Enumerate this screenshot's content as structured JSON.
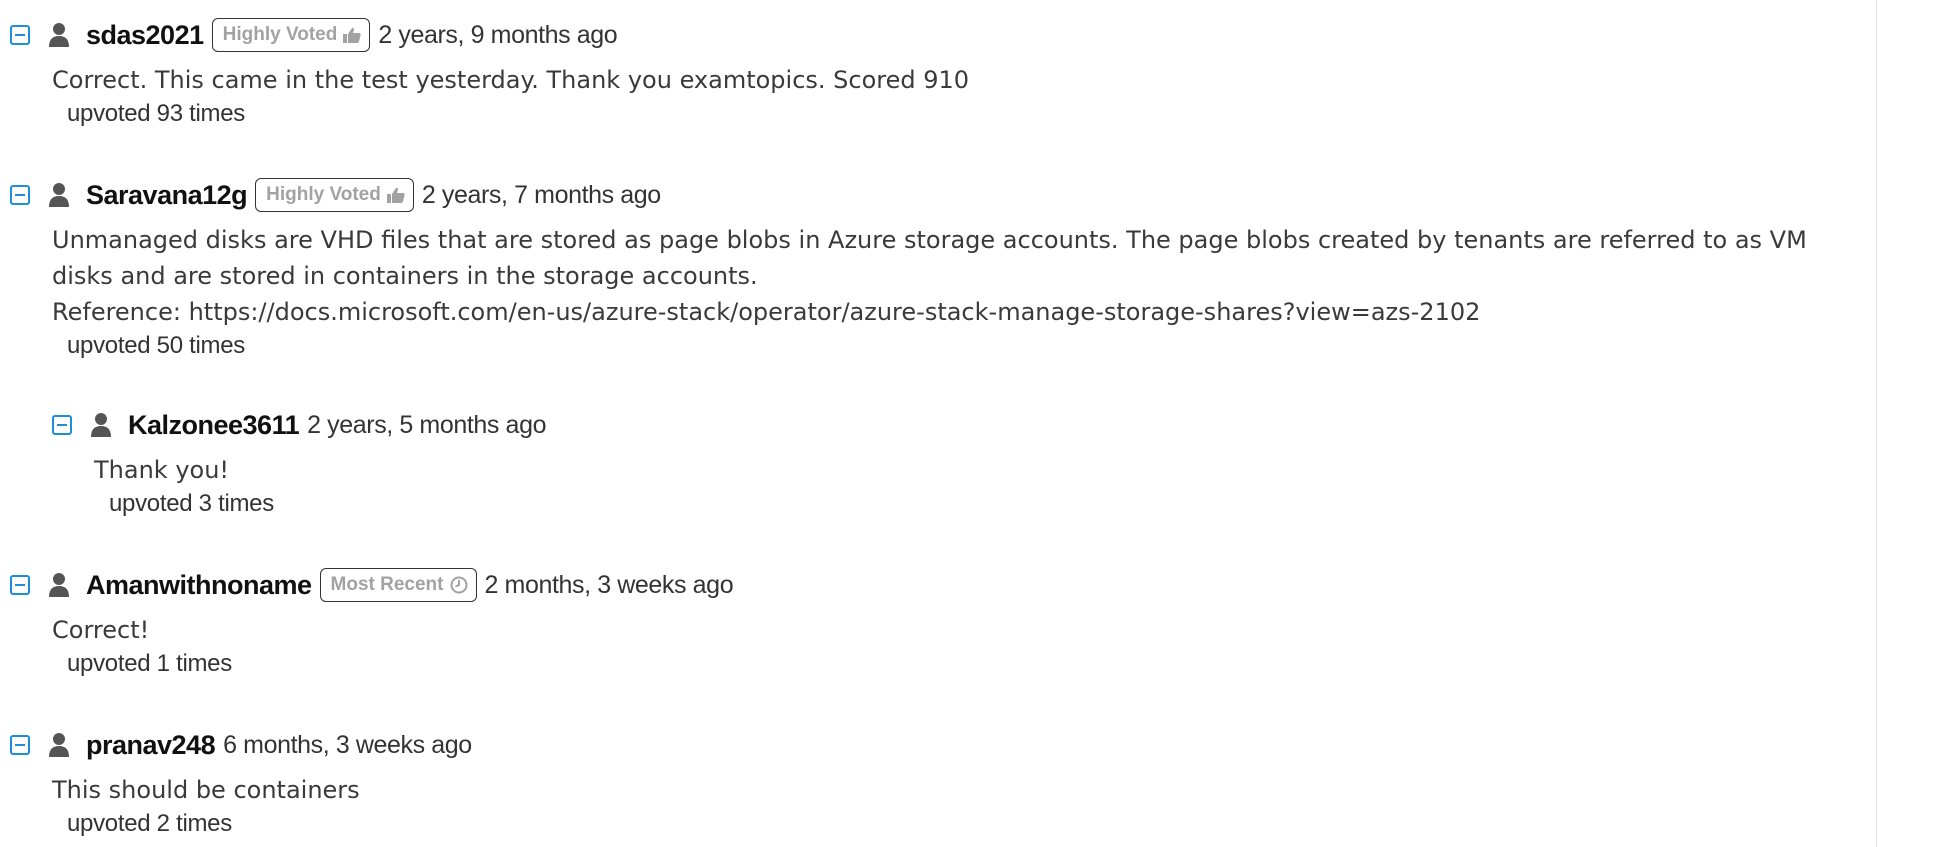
{
  "comments": [
    {
      "username": "sdas2021",
      "badge": "Highly Voted",
      "badge_icon": "thumbs-up-icon",
      "timestamp": "2 years, 9 months ago",
      "body_lines": [
        "Correct. This came in the test yesterday. Thank you examtopics. Scored 910"
      ],
      "upvotes": "upvoted 93 times"
    },
    {
      "username": "Saravana12g",
      "badge": "Highly Voted",
      "badge_icon": "thumbs-up-icon",
      "timestamp": "2 years, 7 months ago",
      "body_lines": [
        "Unmanaged disks are VHD files that are stored as page blobs in Azure storage accounts. The page blobs created by tenants are referred to as VM",
        "disks and are stored in containers in the storage accounts.",
        "Reference: https://docs.microsoft.com/en-us/azure-stack/operator/azure-stack-manage-storage-shares?view=azs-2102"
      ],
      "upvotes": "upvoted 50 times"
    },
    {
      "username": "Kalzonee3611",
      "timestamp": "2 years, 5 months ago",
      "body_lines": [
        "Thank you!"
      ],
      "upvotes": "upvoted 3 times"
    },
    {
      "username": "Amanwithnoname",
      "badge": "Most Recent",
      "badge_icon": "clock-icon",
      "timestamp": "2 months, 3 weeks ago",
      "body_lines": [
        "Correct!"
      ],
      "upvotes": "upvoted 1 times"
    },
    {
      "username": "pranav248",
      "timestamp": "6 months, 3 weeks ago",
      "body_lines": [
        "This should be containers"
      ],
      "upvotes": "upvoted 2 times"
    }
  ],
  "colors": {
    "toggle": "#1c8fd6",
    "badge_text": "#a2a2a2",
    "username": "#111111",
    "body_text": "#3a3a3a"
  }
}
